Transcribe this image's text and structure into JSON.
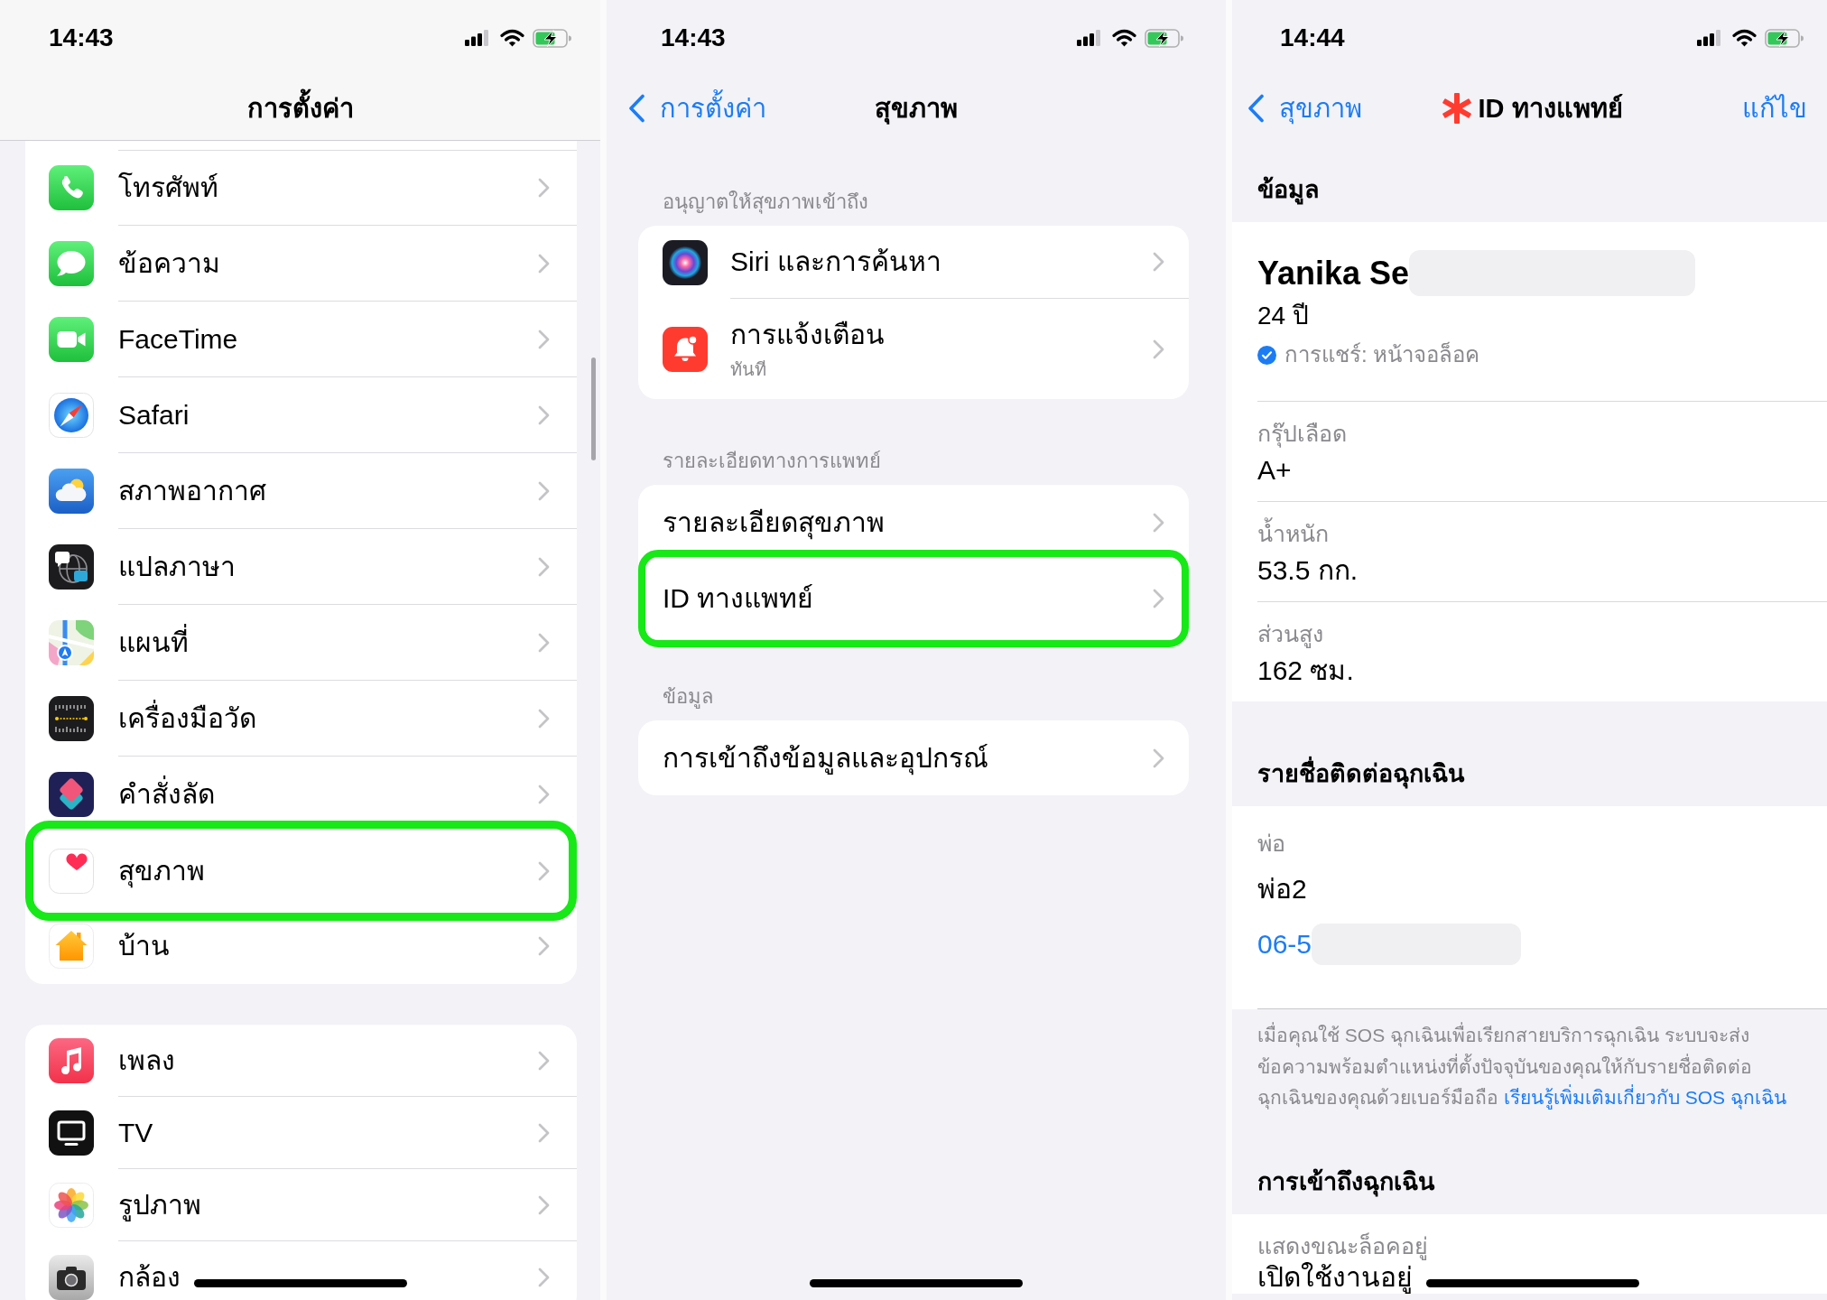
{
  "settings_screen": {
    "status_bar": {
      "time": "14:43"
    },
    "title": "การตั้งค่า",
    "groups": [
      {
        "items": [
          {
            "label": "โทรศัพท์",
            "highlighted": false
          },
          {
            "label": "ข้อความ",
            "highlighted": false
          },
          {
            "label": "FaceTime",
            "highlighted": false
          },
          {
            "label": "Safari",
            "highlighted": false
          },
          {
            "label": "สภาพอากาศ",
            "highlighted": false
          },
          {
            "label": "แปลภาษา",
            "highlighted": false
          },
          {
            "label": "แผนที่",
            "highlighted": false
          },
          {
            "label": "เครื่องมือวัด",
            "highlighted": false
          },
          {
            "label": "คำสั่งลัด",
            "highlighted": false
          },
          {
            "label": "สุขภาพ",
            "highlighted": true
          },
          {
            "label": "บ้าน",
            "highlighted": false
          }
        ]
      },
      {
        "items": [
          {
            "label": "เพลง",
            "highlighted": false
          },
          {
            "label": "TV",
            "highlighted": false
          },
          {
            "label": "รูปภาพ",
            "highlighted": false
          },
          {
            "label": "กล้อง",
            "highlighted": false
          }
        ]
      }
    ]
  },
  "health_screen": {
    "status_bar": {
      "time": "14:43"
    },
    "back": "การตั้งค่า",
    "title": "สุขภาพ",
    "sections": [
      {
        "header": "อนุญาตให้สุขภาพเข้าถึง",
        "items": [
          {
            "kind": "app",
            "label": "Siri และการค้นหา",
            "highlighted": false
          },
          {
            "kind": "app",
            "label": "การแจ้งเตือน",
            "subtitle": "ทันที",
            "highlighted": false
          }
        ]
      },
      {
        "header": "รายละเอียดทางการแพทย์",
        "items": [
          {
            "kind": "plain",
            "label": "รายละเอียดสุขภาพ",
            "highlighted": false
          },
          {
            "kind": "plain",
            "label": "ID ทางแพทย์",
            "highlighted": true
          }
        ]
      },
      {
        "header": "ข้อมูล",
        "items": [
          {
            "kind": "plain",
            "label": "การเข้าถึงข้อมูลและอุปกรณ์",
            "highlighted": false
          }
        ]
      }
    ]
  },
  "medical_id_screen": {
    "status_bar": {
      "time": "14:44"
    },
    "back": "สุขภาพ",
    "title": "ID ทางแพทย์",
    "edit": "แก้ไข",
    "info_section": {
      "header": "ข้อมูล",
      "profile": {
        "name": "Yanika Se",
        "name_redacted": true,
        "age": "24 ปี",
        "sharing": {
          "checked": true,
          "label": "การแชร์: หน้าจอล็อค"
        }
      },
      "fields": [
        {
          "label": "กรุ๊ปเลือด",
          "value": "A+"
        },
        {
          "label": "น้ำหนัก",
          "value": "53.5 กก."
        },
        {
          "label": "ส่วนสูง",
          "value": "162 ซม."
        }
      ]
    },
    "contacts_section": {
      "header": "รายชื่อติดต่อฉุกเฉิน",
      "contacts": [
        {
          "relation": "พ่อ",
          "name": "พ่อ2",
          "phone": "06-5",
          "phone_redacted": true
        }
      ],
      "note": {
        "text": "เมื่อคุณใช้ SOS ฉุกเฉินเพื่อเรียกสายบริการฉุกเฉิน ระบบจะส่งข้อความพร้อมตำแหน่งที่ตั้งปัจจุบันของคุณให้กับรายชื่อติดต่อฉุกเฉินของคุณด้วยเบอร์มือถือ",
        "link": "เรียนรู้เพิ่มเติมเกี่ยวกับ SOS ฉุกเฉิน"
      }
    },
    "access_section": {
      "header": "การเข้าถึงฉุกเฉิน",
      "rows": [
        {
          "label": "แสดงขณะล็อคอยู่",
          "value": "เปิดใช้งานอยู่"
        }
      ]
    }
  }
}
